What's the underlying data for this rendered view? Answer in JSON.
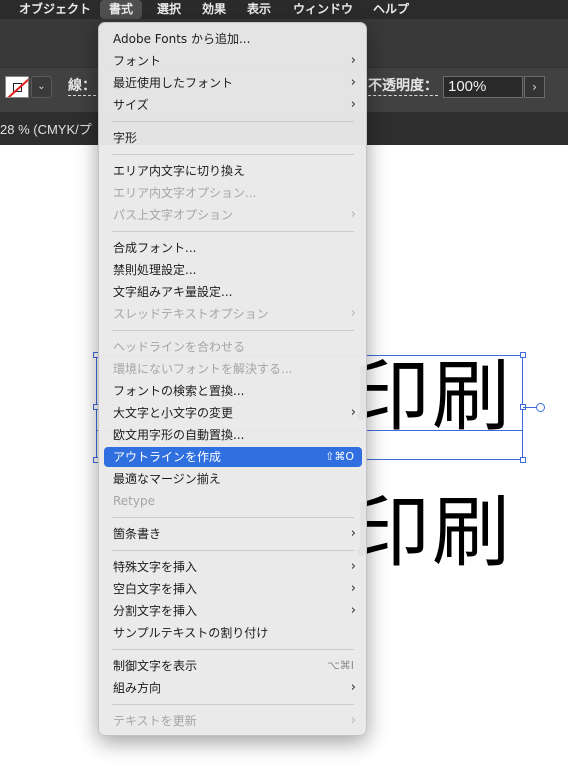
{
  "menubar": {
    "items": [
      "オブジェクト",
      "書式",
      "選択",
      "効果",
      "表示",
      "ウィンドウ",
      "ヘルプ"
    ],
    "active_index": 1
  },
  "control_bar": {
    "stroke_label": "線：",
    "opacity_label": "不透明度：",
    "opacity_value": "100%",
    "stroke_dropdown_icon": "chevron-down-icon",
    "opacity_step_icon": "chevron-right-icon"
  },
  "document": {
    "tab_title": "28 % (CMYK/プ"
  },
  "canvas": {
    "text_top": "印刷",
    "text_bottom": "印刷",
    "selection_color": "#3d6bdc"
  },
  "menu": {
    "highlight_color": "#2f6fe0",
    "items": [
      {
        "label": "Adobe Fonts から追加...",
        "enabled": true
      },
      {
        "label": "フォント",
        "enabled": true,
        "submenu": true
      },
      {
        "label": "最近使用したフォント",
        "enabled": true,
        "submenu": true
      },
      {
        "label": "サイズ",
        "enabled": true,
        "submenu": true
      },
      {
        "label": "字形",
        "enabled": true
      },
      {
        "label": "エリア内文字に切り換え",
        "enabled": true
      },
      {
        "label": "エリア内文字オプション...",
        "enabled": false
      },
      {
        "label": "パス上文字オプション",
        "enabled": false,
        "submenu": true
      },
      {
        "label": "合成フォント...",
        "enabled": true
      },
      {
        "label": "禁則処理設定...",
        "enabled": true
      },
      {
        "label": "文字組みアキ量設定...",
        "enabled": true
      },
      {
        "label": "スレッドテキストオプション",
        "enabled": false,
        "submenu": true
      },
      {
        "label": "ヘッドラインを合わせる",
        "enabled": false
      },
      {
        "label": "環境にないフォントを解決する...",
        "enabled": false
      },
      {
        "label": "フォントの検索と置換...",
        "enabled": true
      },
      {
        "label": "大文字と小文字の変更",
        "enabled": true,
        "submenu": true
      },
      {
        "label": "欧文用字形の自動置換...",
        "enabled": true
      },
      {
        "label": "アウトラインを作成",
        "enabled": true,
        "highlighted": true,
        "shortcut": "⇧⌘O"
      },
      {
        "label": "最適なマージン揃え",
        "enabled": true
      },
      {
        "label": "Retype",
        "enabled": false
      },
      {
        "label": "箇条書き",
        "enabled": true,
        "submenu": true
      },
      {
        "label": "特殊文字を挿入",
        "enabled": true,
        "submenu": true
      },
      {
        "label": "空白文字を挿入",
        "enabled": true,
        "submenu": true
      },
      {
        "label": "分割文字を挿入",
        "enabled": true,
        "submenu": true
      },
      {
        "label": "サンプルテキストの割り付け",
        "enabled": true
      },
      {
        "label": "制御文字を表示",
        "enabled": true,
        "shortcut": "⌥⌘I"
      },
      {
        "label": "組み方向",
        "enabled": true,
        "submenu": true
      },
      {
        "label": "テキストを更新",
        "enabled": false,
        "submenu": true
      }
    ]
  }
}
